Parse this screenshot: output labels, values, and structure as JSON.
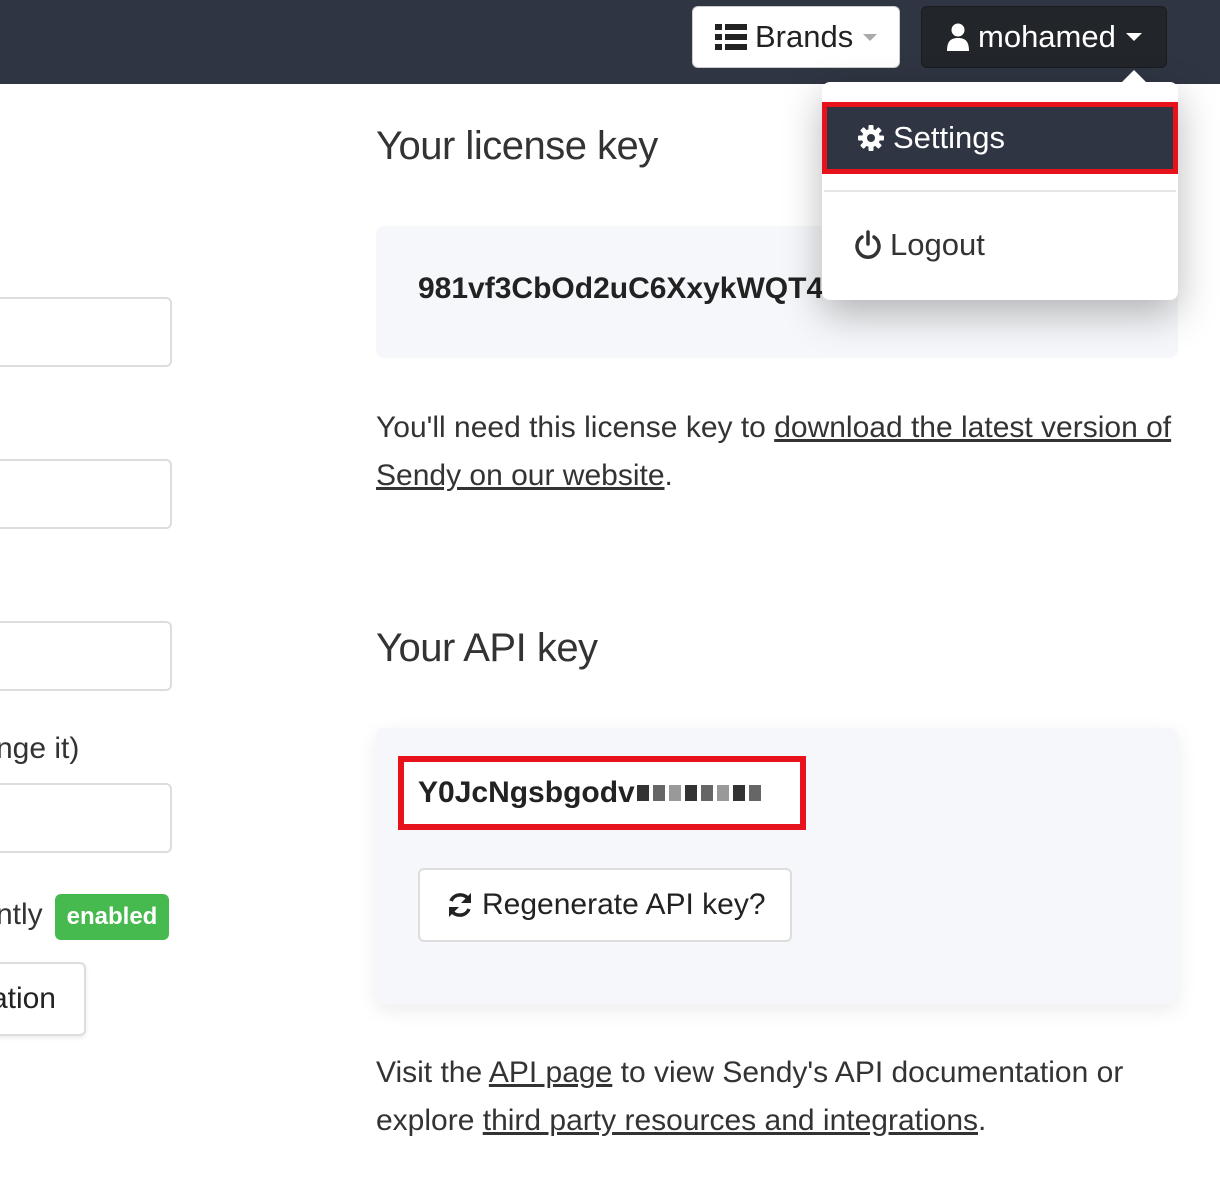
{
  "navbar": {
    "brands_label": "Brands",
    "user_label": "mohamed",
    "bg_color": "#2f3542"
  },
  "dropdown": {
    "settings_label": "Settings",
    "logout_label": "Logout",
    "highlight_color": "#e8121c"
  },
  "left": {
    "text_change": "nge it)",
    "text_currently": "ntly",
    "badge": "enabled",
    "button_partial": "ation"
  },
  "license": {
    "heading": "Your license key",
    "key": "981vf3CbOd2uC6XxykWQT4",
    "desc_prefix": "You'll need this license key to ",
    "desc_link": "download the latest version of Sendy on our website",
    "desc_suffix": "."
  },
  "api": {
    "heading": "Your API key",
    "key": "Y0JcNgsbgodv",
    "regenerate_label": "Regenerate API key?",
    "desc_prefix": "Visit the ",
    "desc_link1": "API page",
    "desc_middle": " to view Sendy's API documentation or explore ",
    "desc_link2": "third party resources and integrations",
    "desc_suffix": "."
  },
  "icons": [
    "list-icon",
    "user-icon",
    "gear-icon",
    "power-icon",
    "refresh-icon"
  ]
}
